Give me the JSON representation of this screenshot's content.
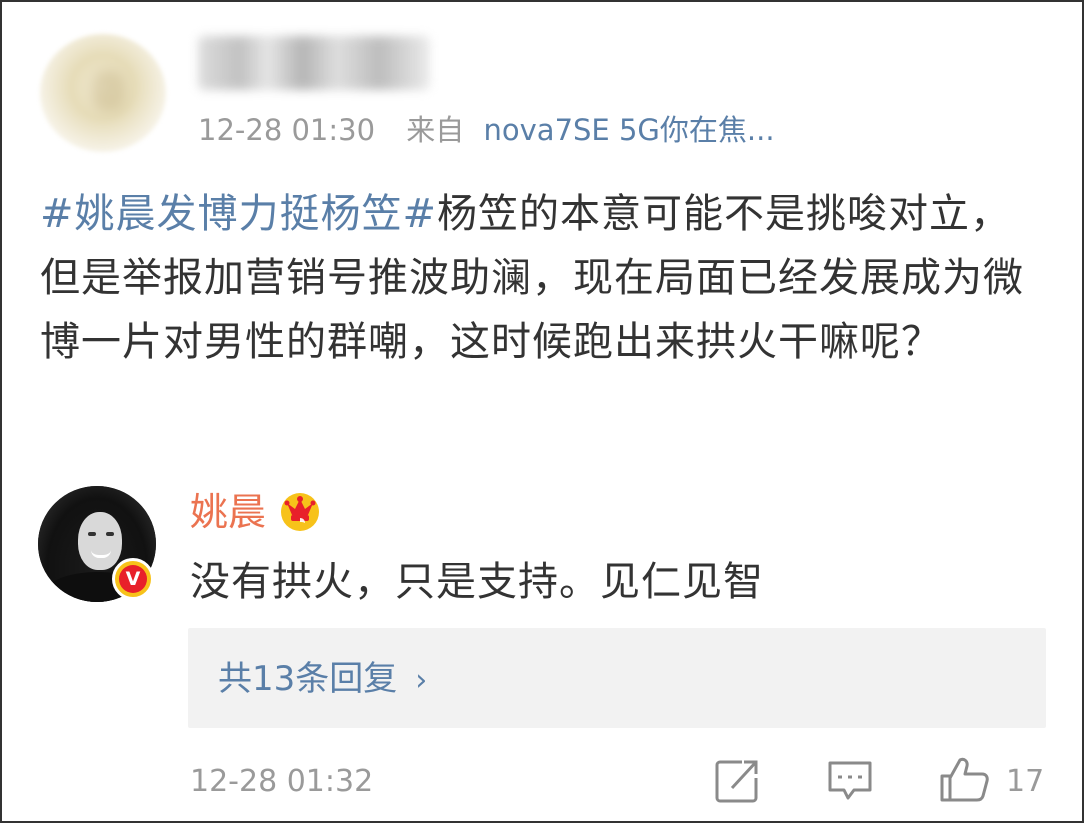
{
  "post": {
    "username": "",
    "time": "12-28 01:30",
    "source_label": "来自",
    "device": "nova7SE 5G你在焦...",
    "hashtag": "#姚晨发博力挺杨笠#",
    "text": "杨笠的本意可能不是挑唆对立，但是举报加营销号推波助澜，现在局面已经发展成为微博一片对男性的群嘲，这时候跑出来拱火干嘛呢？"
  },
  "reply": {
    "name": "姚晨",
    "badge_letter": "V",
    "text": "没有拱火，只是支持。见仁见智",
    "replies_link": "共13条回复",
    "replies_chevron": "›",
    "time": "12-28 01:32",
    "like_count": "17",
    "icons": [
      "crown-icon",
      "verified-icon",
      "share-icon",
      "comment-icon",
      "like-icon"
    ]
  },
  "colors": {
    "link": "#5a7fa8",
    "name": "#eb7350",
    "meta": "#9a9a9a",
    "text": "#333333",
    "replies_bg": "#f2f2f2",
    "badge_yellow": "#f7c21a",
    "badge_red": "#e8202a"
  }
}
